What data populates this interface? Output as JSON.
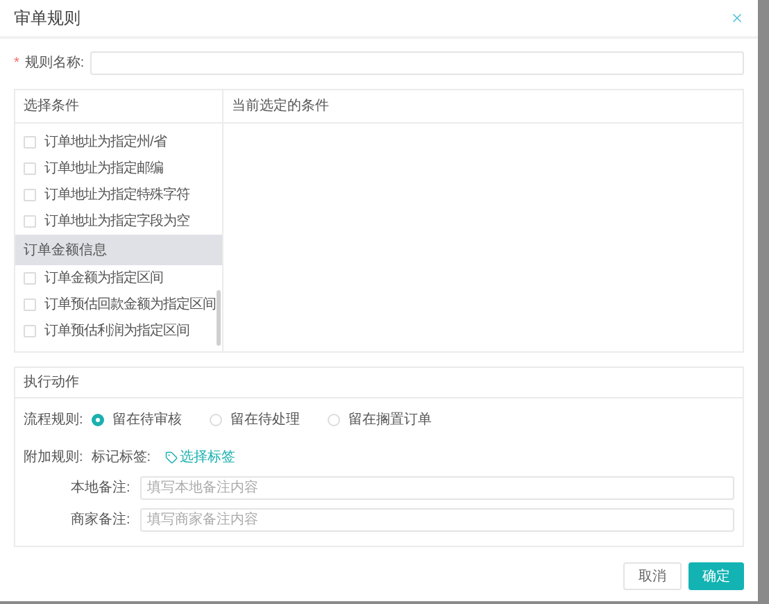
{
  "dialog": {
    "title": "审单规则"
  },
  "rule_name": {
    "required_mark": "*",
    "label": "规则名称:"
  },
  "conditions": {
    "left_header": "选择条件",
    "right_header": "当前选定的条件",
    "items": [
      {
        "kind": "checkbox",
        "label": "订单地址为指定州/省",
        "checked": false
      },
      {
        "kind": "checkbox",
        "label": "订单地址为指定邮编",
        "checked": false
      },
      {
        "kind": "checkbox",
        "label": "订单地址为指定特殊字符",
        "checked": false
      },
      {
        "kind": "checkbox",
        "label": "订单地址为指定字段为空",
        "checked": false
      },
      {
        "kind": "group",
        "label": "订单金额信息"
      },
      {
        "kind": "checkbox",
        "label": "订单金额为指定区间",
        "checked": false
      },
      {
        "kind": "checkbox",
        "label": "订单预估回款金额为指定区间",
        "checked": false
      },
      {
        "kind": "checkbox",
        "label": "订单预估利润为指定区间",
        "checked": false
      }
    ]
  },
  "actions": {
    "header": "执行动作",
    "flow_label": "流程规则:",
    "flow_options": [
      {
        "label": "留在待审核",
        "selected": true
      },
      {
        "label": "留在待处理",
        "selected": false
      },
      {
        "label": "留在搁置订单",
        "selected": false
      }
    ],
    "extra_label": "附加规则:",
    "tag_label": "标记标签:",
    "tag_link": "选择标签",
    "fields": [
      {
        "label": "本地备注:",
        "placeholder": "填写本地备注内容"
      },
      {
        "label": "商家备注:",
        "placeholder": "填写商家备注内容"
      }
    ]
  },
  "buttons": [
    {
      "kind": "secondary",
      "label": "取消"
    },
    {
      "kind": "primary",
      "label": "确定"
    }
  ]
}
